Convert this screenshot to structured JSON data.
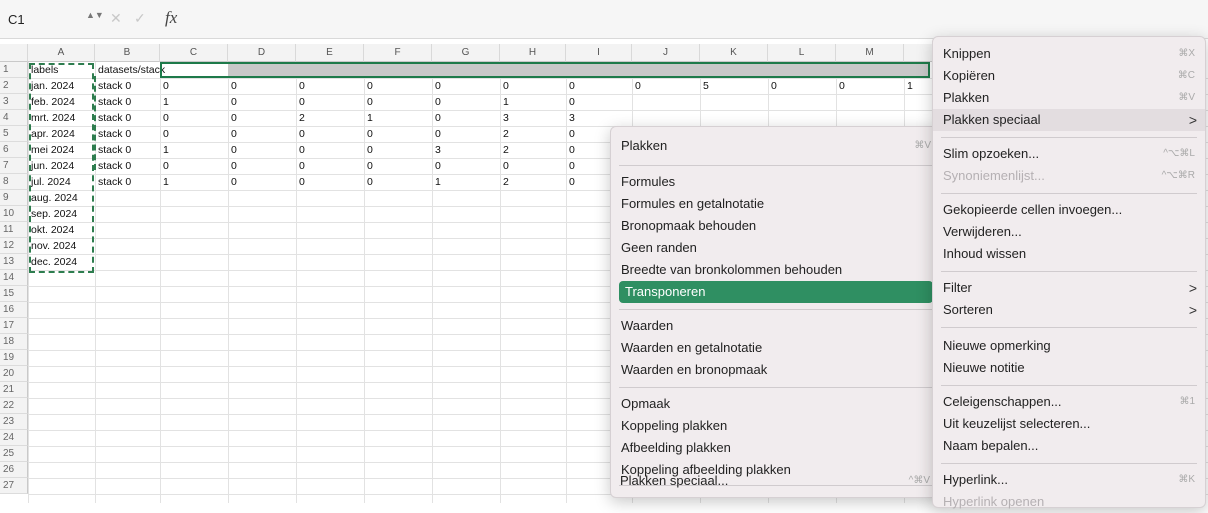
{
  "formula_bar": {
    "cell_ref": "C1",
    "fx": "fx",
    "cancel": "✕",
    "enter": "✓",
    "stepper": "▲▼"
  },
  "columns": [
    "A",
    "B",
    "C",
    "D",
    "E",
    "F",
    "G",
    "H",
    "I",
    "J",
    "K",
    "L",
    "M",
    "N"
  ],
  "rows": [
    "1",
    "2",
    "3",
    "4",
    "5",
    "6",
    "7",
    "8",
    "9",
    "10",
    "11",
    "12",
    "13",
    "14",
    "15",
    "16",
    "17",
    "18",
    "19",
    "20",
    "21",
    "22",
    "23",
    "24",
    "25",
    "26",
    "27"
  ],
  "cells": {
    "A": [
      "labels",
      "jan. 2024",
      "feb. 2024",
      "mrt. 2024",
      "apr. 2024",
      "mei 2024",
      "jun. 2024",
      "jul. 2024",
      "aug. 2024",
      "sep. 2024",
      "okt. 2024",
      "nov. 2024",
      "dec. 2024"
    ],
    "B": [
      "datasets/stack",
      "stack 0",
      "stack 0",
      "stack 0",
      "stack 0",
      "stack 0",
      "stack 0",
      "stack 0"
    ],
    "C": [
      "",
      "0",
      "1",
      "0",
      "0",
      "1",
      "0",
      "1"
    ],
    "D": [
      "",
      "0",
      "0",
      "0",
      "0",
      "0",
      "0",
      "0"
    ],
    "E": [
      "",
      "0",
      "0",
      "2",
      "0",
      "0",
      "0",
      "0"
    ],
    "F": [
      "",
      "0",
      "0",
      "1",
      "0",
      "0",
      "0",
      "0"
    ],
    "G": [
      "",
      "0",
      "0",
      "0",
      "0",
      "3",
      "0",
      "1"
    ],
    "H": [
      "",
      "0",
      "1",
      "3",
      "2",
      "2",
      "0",
      "2"
    ],
    "I": [
      "",
      "0",
      "0",
      "3",
      "0",
      "0",
      "0",
      "0"
    ],
    "J": [
      "",
      "0"
    ],
    "K": [
      "",
      "5"
    ],
    "L": [
      "",
      "0"
    ],
    "M": [
      "",
      "0"
    ],
    "N": [
      "",
      "1"
    ]
  },
  "paste_menu": {
    "items": [
      {
        "label": "Plakken",
        "shortcut": "⌘V"
      },
      {
        "label": "Formules",
        "shortcut": ""
      },
      {
        "label": "Formules en getalnotatie",
        "shortcut": ""
      },
      {
        "label": "Bronopmaak behouden",
        "shortcut": ""
      },
      {
        "label": "Geen randen",
        "shortcut": ""
      },
      {
        "label": "Breedte van bronkolommen behouden",
        "shortcut": ""
      },
      {
        "label": "Transponeren",
        "shortcut": ""
      },
      {
        "label": "Waarden",
        "shortcut": ""
      },
      {
        "label": "Waarden en getalnotatie",
        "shortcut": ""
      },
      {
        "label": "Waarden en bronopmaak",
        "shortcut": ""
      },
      {
        "label": "Opmaak",
        "shortcut": ""
      },
      {
        "label": "Koppeling plakken",
        "shortcut": ""
      },
      {
        "label": "Afbeelding plakken",
        "shortcut": ""
      },
      {
        "label": "Koppeling afbeelding plakken",
        "shortcut": ""
      },
      {
        "label": "Plakken speciaal...",
        "shortcut": "^⌘V"
      }
    ]
  },
  "context_menu": {
    "items": [
      {
        "label": "Knippen",
        "shortcut": "⌘X"
      },
      {
        "label": "Kopiëren",
        "shortcut": "⌘C"
      },
      {
        "label": "Plakken",
        "shortcut": "⌘V"
      },
      {
        "label": "Plakken speciaal",
        "shortcut": ">"
      },
      {
        "label": "Slim opzoeken...",
        "shortcut": "^⌥⌘L"
      },
      {
        "label": "Synoniemenlijst...",
        "shortcut": "^⌥⌘R"
      },
      {
        "label": "Gekopieerde cellen invoegen...",
        "shortcut": ""
      },
      {
        "label": "Verwijderen...",
        "shortcut": ""
      },
      {
        "label": "Inhoud wissen",
        "shortcut": ""
      },
      {
        "label": "Filter",
        "shortcut": ">"
      },
      {
        "label": "Sorteren",
        "shortcut": ">"
      },
      {
        "label": "Nieuwe opmerking",
        "shortcut": ""
      },
      {
        "label": "Nieuwe notitie",
        "shortcut": ""
      },
      {
        "label": "Celeigenschappen...",
        "shortcut": "⌘1"
      },
      {
        "label": "Uit keuzelijst selecteren...",
        "shortcut": ""
      },
      {
        "label": "Naam bepalen...",
        "shortcut": ""
      },
      {
        "label": "Hyperlink...",
        "shortcut": "⌘K"
      },
      {
        "label": "Hyperlink openen",
        "shortcut": ""
      }
    ]
  },
  "colors": {
    "accent": "#2f8f62",
    "selection_border": "#1e7a4a"
  }
}
